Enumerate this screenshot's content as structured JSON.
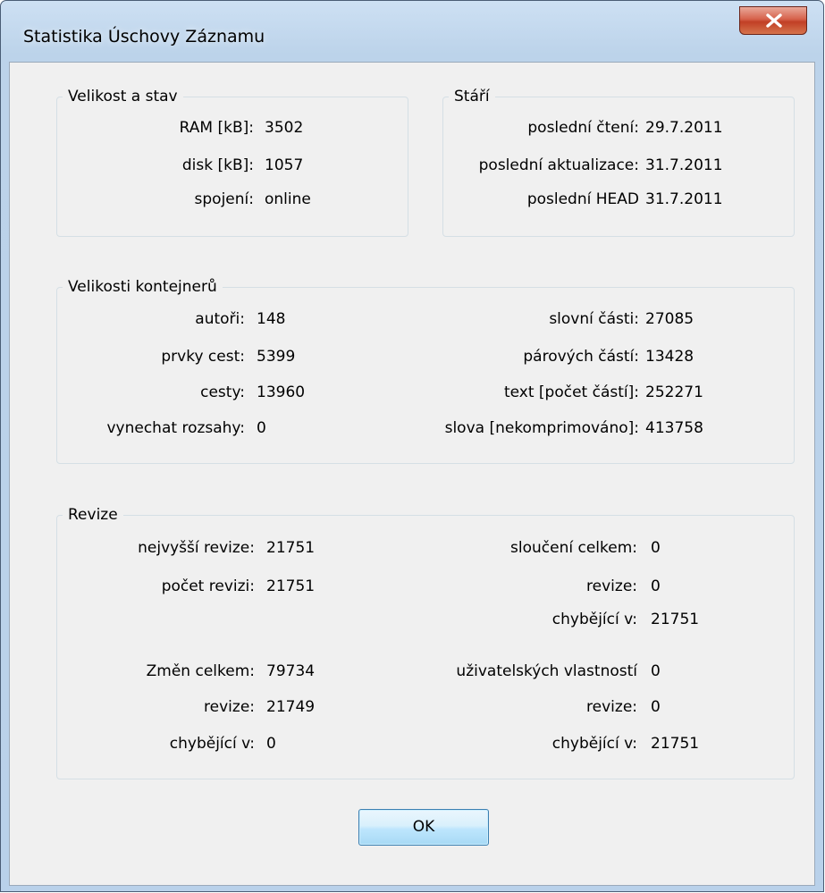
{
  "window": {
    "title": "Statistika Úschovy Záznamu",
    "close_label": "X"
  },
  "size_state": {
    "title": "Velikost a stav",
    "rows": [
      {
        "label": "RAM [kB]:",
        "value": "3502"
      },
      {
        "label": "disk [kB]:",
        "value": "1057"
      },
      {
        "label": "spojení:",
        "value": "online"
      }
    ]
  },
  "age": {
    "title": "Stáří",
    "rows": [
      {
        "label": "poslední čtení:",
        "value": "29.7.2011"
      },
      {
        "label": "poslední aktualizace:",
        "value": "31.7.2011"
      },
      {
        "label": "poslední HEAD",
        "value": "31.7.2011"
      }
    ]
  },
  "containers": {
    "title": "Velikosti kontejnerů",
    "left": [
      {
        "label": "autoři:",
        "value": "148"
      },
      {
        "label": "prvky cest:",
        "value": "5399"
      },
      {
        "label": "cesty:",
        "value": "13960"
      },
      {
        "label": "vynechat rozsahy:",
        "value": "0"
      }
    ],
    "right": [
      {
        "label": "slovní části:",
        "value": "27085"
      },
      {
        "label": "párových částí:",
        "value": "13428"
      },
      {
        "label": "text [počet částí]:",
        "value": "252271"
      },
      {
        "label": "slova [nekomprimováno]:",
        "value": "413758"
      }
    ]
  },
  "revisions": {
    "title": "Revize",
    "left_top": [
      {
        "label": "nejvyšší revize:",
        "value": "21751"
      },
      {
        "label": "počet revizi:",
        "value": "21751"
      }
    ],
    "right_top": [
      {
        "label": "sloučení celkem:",
        "value": "0"
      },
      {
        "label": "revize:",
        "value": "0"
      },
      {
        "label": "chybějící v:",
        "value": "21751"
      }
    ],
    "left_bottom": [
      {
        "label": "Změn celkem:",
        "value": "79734"
      },
      {
        "label": "revize:",
        "value": "21749"
      },
      {
        "label": "chybějící v:",
        "value": "0"
      }
    ],
    "right_bottom": [
      {
        "label": "uživatelských vlastností",
        "value": "0"
      },
      {
        "label": "revize:",
        "value": "0"
      },
      {
        "label": "chybějící v:",
        "value": "21751"
      }
    ]
  },
  "buttons": {
    "ok": "OK"
  }
}
